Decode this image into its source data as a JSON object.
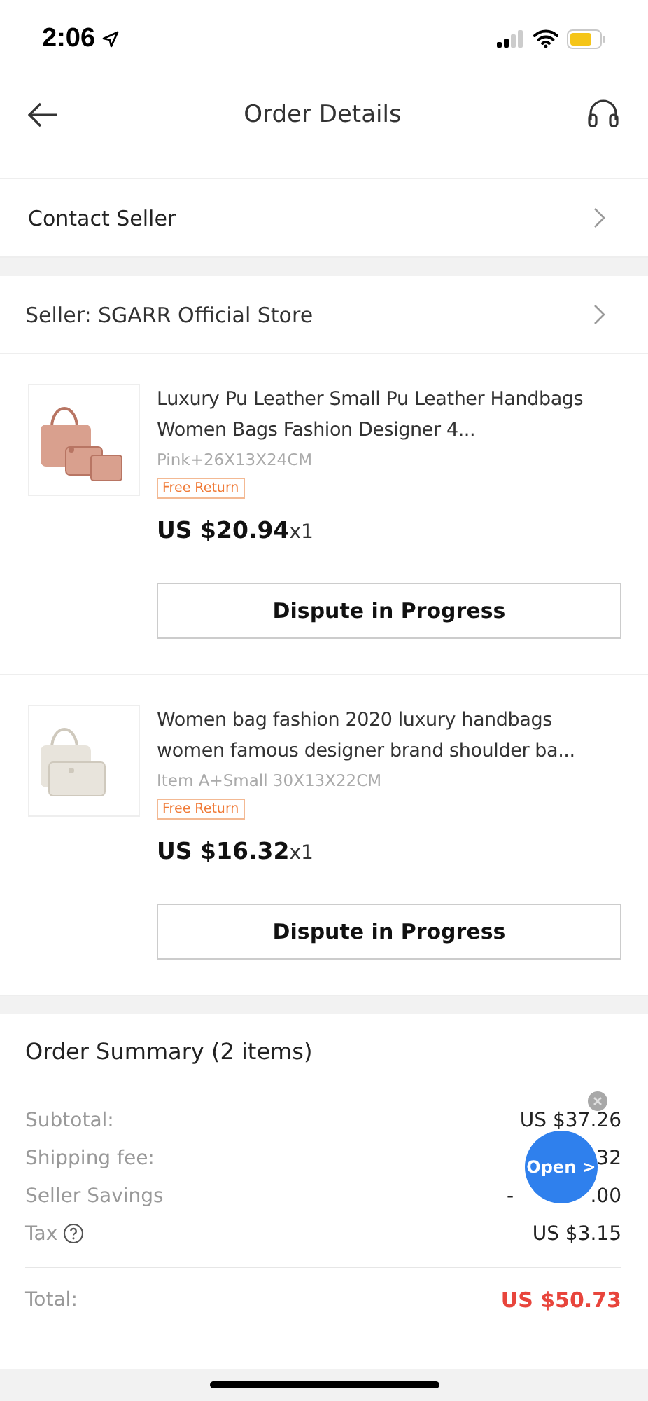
{
  "status_bar": {
    "time": "2:06"
  },
  "header": {
    "title": "Order Details"
  },
  "links": [
    {
      "label": "Contact Seller"
    }
  ],
  "seller": {
    "label": "Seller: SGARR Official Store"
  },
  "products": [
    {
      "title": "Luxury Pu Leather Small Pu Leather Handbags Women Bags Fashion Designer 4...",
      "variant": "Pink+26X13X24CM",
      "tag": "Free Return",
      "price": "US $20.94",
      "quantity": "x1",
      "action": "Dispute in Progress"
    },
    {
      "title": "Women bag fashion 2020 luxury handbags women famous designer brand shoulder ba...",
      "variant": "Item A+Small  30X13X22CM",
      "tag": "Free Return",
      "price": "US $16.32",
      "quantity": "x1",
      "action": "Dispute in Progress"
    }
  ],
  "summary": {
    "title": "Order Summary (2 items)",
    "rows": [
      {
        "label": "Subtotal:",
        "value": "US $37.26",
        "help": false
      },
      {
        "label": "Shipping fee:",
        "value_end": "32",
        "help": false
      },
      {
        "label": "Seller Savings",
        "value_start": "-",
        "value_end": ".00",
        "help": false
      },
      {
        "label": "Tax",
        "value": "US $3.15",
        "help": true
      }
    ],
    "total": {
      "label": "Total:",
      "value": "US $50.73"
    }
  },
  "floating_button": {
    "label": "Open >"
  }
}
